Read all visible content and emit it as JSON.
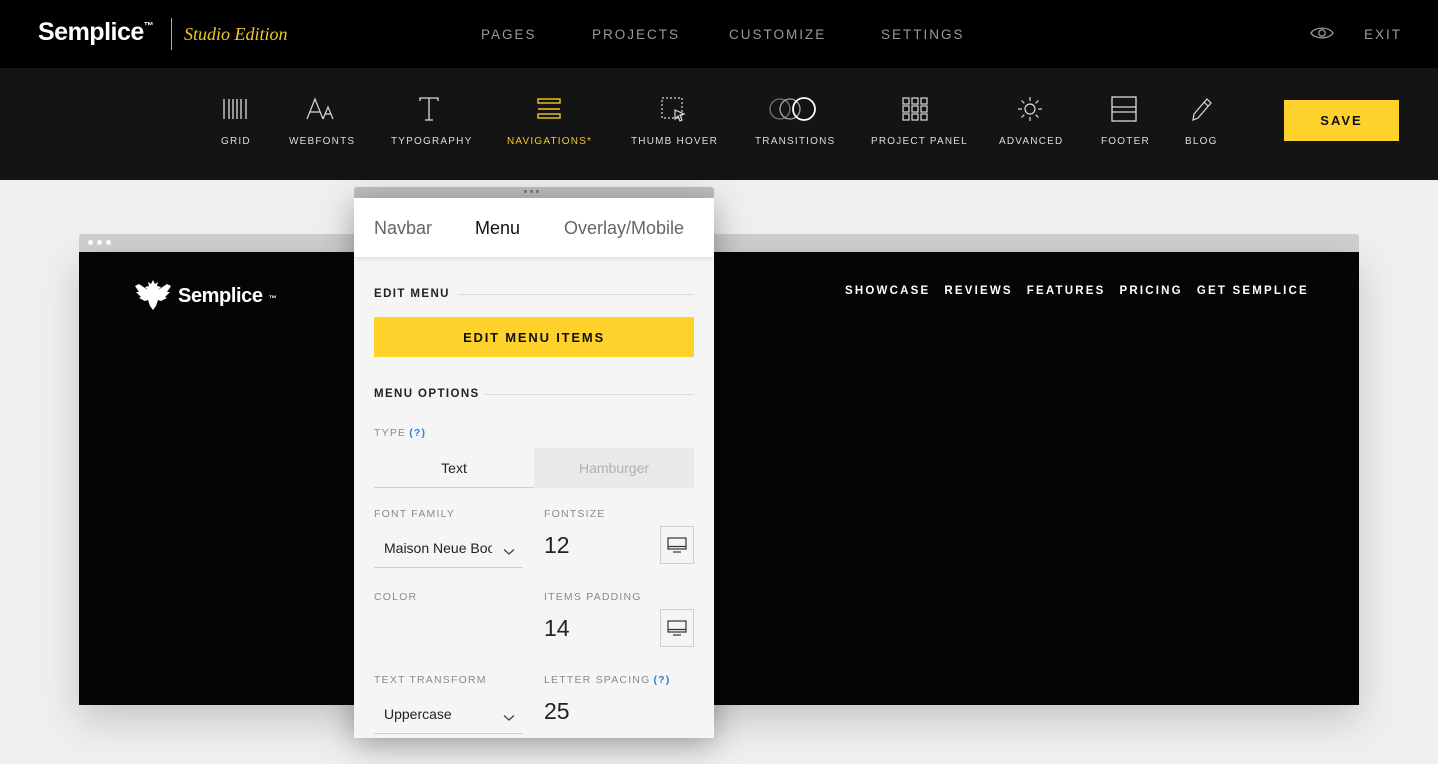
{
  "topbar": {
    "brand": "Semplice",
    "brand_mark": "™",
    "edition": "Studio Edition",
    "nav": [
      "PAGES",
      "PROJECTS",
      "CUSTOMIZE",
      "SETTINGS"
    ],
    "exit_label": "EXIT",
    "preview_icon": "eye-icon"
  },
  "toolbar": {
    "items": [
      {
        "label": "GRID",
        "icon": "grid-icon"
      },
      {
        "label": "WEBFONTS",
        "icon": "webfonts-icon"
      },
      {
        "label": "TYPOGRAPHY",
        "icon": "typography-icon"
      },
      {
        "label": "NAVIGATIONS*",
        "icon": "navigations-icon",
        "active": true
      },
      {
        "label": "THUMB HOVER",
        "icon": "thumb-hover-icon"
      },
      {
        "label": "TRANSITIONS",
        "icon": "transitions-icon"
      },
      {
        "label": "PROJECT PANEL",
        "icon": "project-panel-icon"
      },
      {
        "label": "ADVANCED",
        "icon": "advanced-icon"
      },
      {
        "label": "FOOTER",
        "icon": "footer-icon"
      },
      {
        "label": "BLOG",
        "icon": "blog-icon"
      }
    ],
    "save_label": "SAVE"
  },
  "preview": {
    "logo": "Semplice",
    "logo_mark": "™",
    "menu": [
      "SHOWCASE",
      "REVIEWS",
      "FEATURES",
      "PRICING",
      "GET SEMPLICE"
    ]
  },
  "panel": {
    "tabs": [
      "Navbar",
      "Menu",
      "Overlay/Mobile"
    ],
    "active_tab": "Menu",
    "edit_menu_title": "EDIT MENU",
    "edit_menu_button": "EDIT MENU ITEMS",
    "menu_options_title": "MENU OPTIONS",
    "type_label": "TYPE",
    "help": "(?)",
    "type_options": [
      "Text",
      "Hamburger"
    ],
    "type_selected": "Text",
    "font_family_label": "FONT FAMILY",
    "font_family_value": "Maison Neue Book",
    "fontsize_label": "FONTSIZE",
    "fontsize_value": "12",
    "color_label": "COLOR",
    "items_padding_label": "ITEMS PADDING",
    "items_padding_value": "14",
    "text_transform_label": "TEXT TRANSFORM",
    "text_transform_value": "Uppercase",
    "letter_spacing_label": "LETTER SPACING",
    "letter_spacing_value": "25"
  },
  "colors": {
    "accent": "#ffd22b",
    "edition": "#f2c925",
    "help_link": "#2a7fd4"
  }
}
